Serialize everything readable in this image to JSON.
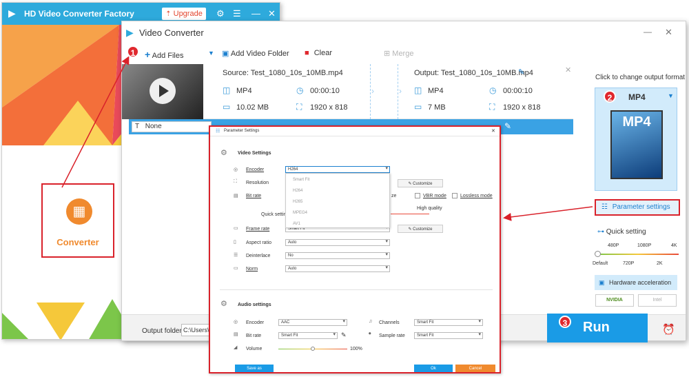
{
  "back_app": {
    "title": "HD Video Converter Factory",
    "upgrade": "Upgrade",
    "converter_label": "Converter"
  },
  "window": {
    "title": "Video Converter"
  },
  "toolbar": {
    "add_files": "Add Files",
    "add_video_folder": "Add Video Folder",
    "clear": "Clear",
    "merge": "Merge"
  },
  "file": {
    "source": "Source: Test_1080_10s_10MB.mp4",
    "output": "Output: Test_1080_10s_10MB.mp4",
    "src_format": "MP4",
    "src_duration": "00:00:10",
    "src_size": "10.02 MB",
    "src_resolution": "1920 x 818",
    "out_format": "MP4",
    "out_duration": "00:00:10",
    "out_size": "7 MB",
    "out_resolution": "1920 x 818",
    "subtitle": "None"
  },
  "right_panel": {
    "click_to_change": "Click to change output format:",
    "format": "MP4",
    "format_icon_text": "MP4",
    "parameter_settings": "Parameter settings",
    "quick_setting": "Quick setting",
    "quality_top": [
      "480P",
      "1080P",
      "4K"
    ],
    "quality_bottom": [
      "Default",
      "720P",
      "2K"
    ],
    "hardware_acceleration": "Hardware acceleration",
    "nvidia": "NVIDIA",
    "intel": "Intel"
  },
  "bottom": {
    "output_folder_label": "Output folder:",
    "output_folder_value": "C:\\Users\\W",
    "run": "Run"
  },
  "badges": {
    "one": "1",
    "two": "2",
    "three": "3"
  },
  "dialog": {
    "title": "Parameter Settings",
    "video_settings": "Video Settings",
    "encoder_label": "Encoder",
    "encoder_value": "H264",
    "encoder_options": [
      "Smart Fit",
      "H264",
      "H265",
      "MPEG4",
      "AV1"
    ],
    "resolution_label": "Resolution",
    "bitrate_label": "Bit rate",
    "quick_setting": "Quick setting",
    "high_quality": "High quality",
    "customize": "Customize",
    "vbr_mode": "VBR mode",
    "lossless_mode": "Lossless mode",
    "ze_fragment": "ze",
    "frame_rate_label": "Frame rate",
    "frame_rate_value": "Smart Fit",
    "aspect_ratio_label": "Aspect ratio",
    "aspect_ratio_value": "Auto",
    "deinterlace_label": "Deinterlace",
    "deinterlace_value": "No",
    "norm_label": "Norm",
    "norm_value": "Auto",
    "audio_settings": "Audio settings",
    "a_encoder_label": "Encoder",
    "a_encoder_value": "AAC",
    "channels_label": "Channels",
    "channels_value": "Smart Fit",
    "a_bitrate_label": "Bit rate",
    "a_bitrate_value": "Smart Fit",
    "sample_rate_label": "Sample rate",
    "sample_rate_value": "Smart Fit",
    "volume_label": "Volume",
    "volume_value": "100%",
    "save_as": "Save as",
    "ok": "Ok",
    "cancel": "Cancel"
  },
  "colors": {
    "accent": "#1a9be6",
    "red": "#d9212a",
    "orange": "#f08a2e"
  }
}
